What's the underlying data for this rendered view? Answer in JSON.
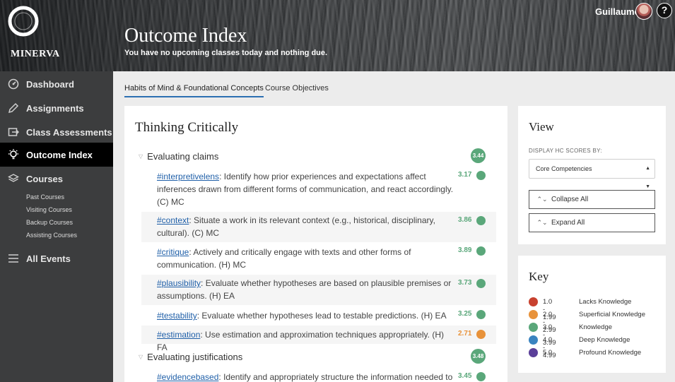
{
  "app": {
    "logo_text": "MINERVA",
    "title": "Outcome Index",
    "subtitle": "You have no upcoming classes today and nothing due.",
    "user_name": "Guillaume",
    "help_label": "?"
  },
  "sidebar": {
    "items": [
      {
        "label": "Dashboard",
        "icon": "dashboard-gauge-icon"
      },
      {
        "label": "Assignments",
        "icon": "pencil-icon"
      },
      {
        "label": "Class Assessments",
        "icon": "assessment-arrow-icon"
      },
      {
        "label": "Outcome Index",
        "icon": "lightbulb-icon",
        "active": true
      },
      {
        "label": "Courses",
        "icon": "layers-icon"
      },
      {
        "label": "All Events",
        "icon": "hamburger-menu-icon"
      }
    ],
    "sub_items": [
      "Past Courses",
      "Visiting Courses",
      "Backup Courses",
      "Assisting Courses"
    ]
  },
  "tabs": [
    {
      "label": "Habits of Mind & Foundational Concepts",
      "active": true
    },
    {
      "label": "Course Objectives",
      "active": false
    }
  ],
  "main": {
    "title": "Thinking Critically",
    "groups": [
      {
        "name": "Evaluating claims",
        "score": "3.44",
        "items": [
          {
            "tag": "#interpretivelens",
            "text": ": Identify how prior experiences and expectations affect inferences drawn from different forms of communication, and react accordingly. (C) MC",
            "score": "3.17",
            "level": "knowledge"
          },
          {
            "tag": "#context",
            "text": ": Situate a work in its relevant context (e.g., historical, disciplinary, cultural). (C) MC",
            "score": "3.86",
            "level": "knowledge"
          },
          {
            "tag": "#critique",
            "text": ": Actively and critically engage with texts and other forms of communication. (H) MC",
            "score": "3.89",
            "level": "knowledge"
          },
          {
            "tag": "#plausibility",
            "text": ": Evaluate whether hypotheses are based on plausible premises or assumptions. (H) EA",
            "score": "3.73",
            "level": "knowledge"
          },
          {
            "tag": "#testability",
            "text": ": Evaluate whether hypotheses lead to testable predictions. (H) EA",
            "score": "3.25",
            "level": "knowledge"
          },
          {
            "tag": "#estimation",
            "text": ": Use estimation and approximation techniques appropriately. (H) FA",
            "score": "2.71",
            "level": "superficial"
          }
        ]
      },
      {
        "name": "Evaluating justifications",
        "score": "3.48",
        "items": [
          {
            "tag": "#evidencebased",
            "text": ": Identify and appropriately structure the information needed to",
            "score": "3.45",
            "level": "knowledge"
          }
        ]
      }
    ]
  },
  "view": {
    "title": "View",
    "display_label": "DISPLAY HC SCORES BY:",
    "select_value": "Core Competencies",
    "collapse_label": "Collapse All",
    "expand_label": "Expand All"
  },
  "key": {
    "title": "Key",
    "entries": [
      {
        "range": "1.0 - 1.99",
        "label": "Lacks Knowledge",
        "color": "#c8412f"
      },
      {
        "range": "2.0 - 2.99",
        "label": "Superficial Knowledge",
        "color": "#e8923a"
      },
      {
        "range": "3.0 - 3.99",
        "label": "Knowledge",
        "color": "#5aa77a"
      },
      {
        "range": "4.0 - 4.99",
        "label": "Deep Knowledge",
        "color": "#3a84c0"
      },
      {
        "range": "5.0",
        "label": "Profound Knowledge",
        "color": "#5b3f99"
      }
    ]
  },
  "colors": {
    "knowledge": "#5aa77a",
    "superficial": "#e8923a",
    "link": "#1f5fa8",
    "tab_underline": "#2c6fb2"
  }
}
